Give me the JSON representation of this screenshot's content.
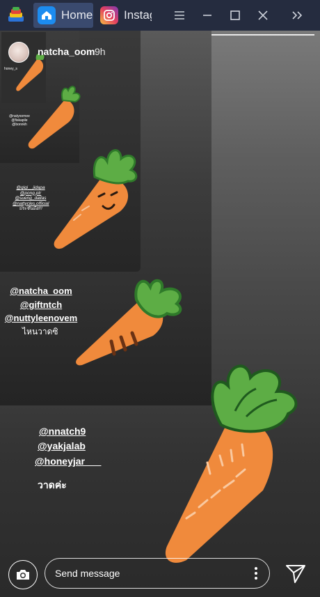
{
  "window": {
    "tabs": [
      {
        "label": "Home",
        "icon": "home-icon"
      },
      {
        "label": "Instagram",
        "icon": "instagram-icon"
      }
    ],
    "controls": [
      "menu-icon",
      "minimize-icon",
      "maximize-icon",
      "close-icon",
      "collapse-icon"
    ],
    "accent": "#252c3f"
  },
  "story": {
    "username": "natcha_oom",
    "time": "9h",
    "nested_tiny_label": "honey_s",
    "nested_inner_text": [
      "@natyoomee",
      "@fiskapile",
      "@bonnkh"
    ],
    "nested_mid_text": [
      "@gigi__jidapa",
      "@pong.ptr",
      "@sueng_dallas",
      "@nattycles.official",
      "ประชันมือ!!!"
    ],
    "mentions_level1": [
      "@natcha_oom",
      "@giftntch",
      "@nuttyleenovem"
    ],
    "caption_level1": "ไหนวาดซิ",
    "mentions_level0": [
      "@nnatch9",
      "@yakjalab",
      "@honeyjar___"
    ],
    "caption_level0": "วาดค่ะ",
    "carrot_colors": {
      "body": "#f08a3c",
      "leaf": "#5dad45",
      "leaf_dark": "#2f7a2a"
    }
  },
  "footer": {
    "message_placeholder": "Send message"
  }
}
